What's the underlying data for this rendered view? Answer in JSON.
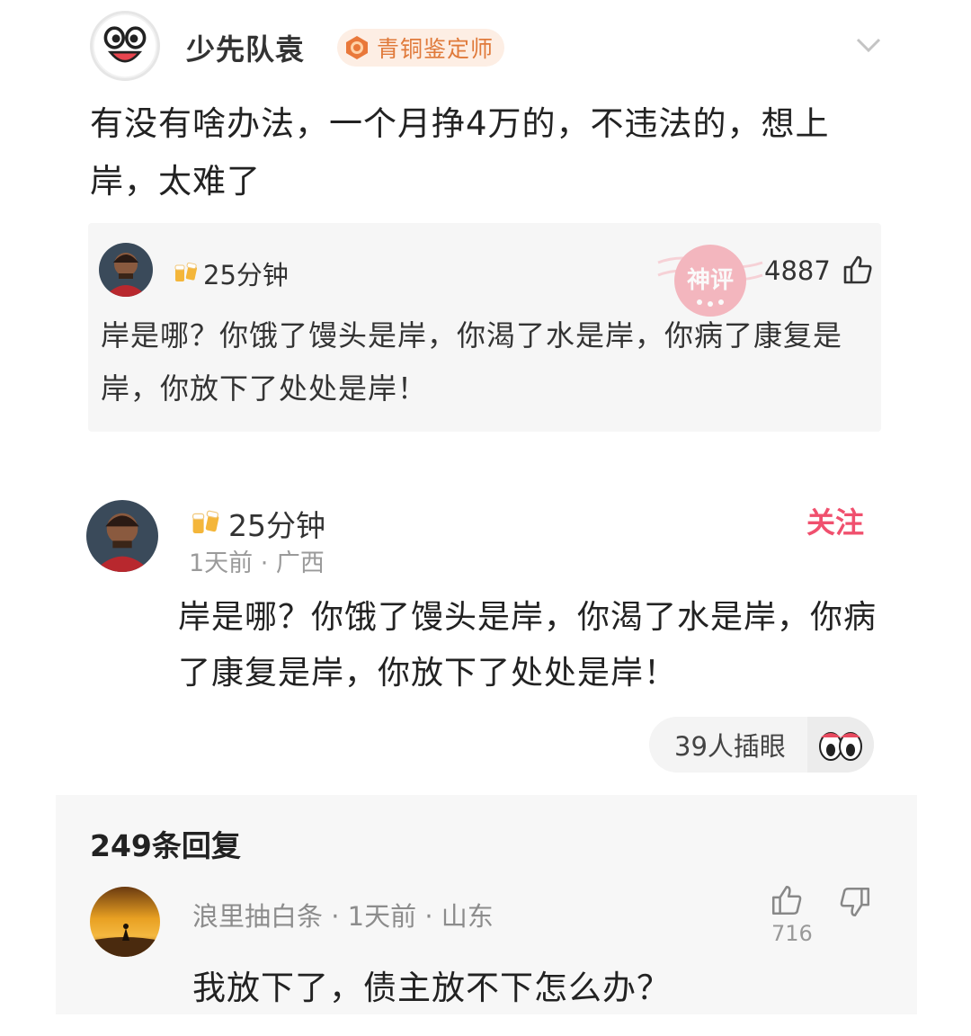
{
  "post": {
    "username": "少先队袁",
    "badge": {
      "label": "青铜鉴定师",
      "icon": "bronze-medal-icon"
    },
    "text": "有没有啥办法，一个月挣4万的，不违法的，想上岸，太难了"
  },
  "quoted_comment": {
    "name": "25分钟",
    "likes": "4887",
    "stamp_text": "神评",
    "text": "岸是哪？你饿了馒头是岸，你渴了水是岸，你病了康复是岸，你放下了处处是岸！"
  },
  "comment": {
    "name": "25分钟",
    "meta": "1天前 · 广西",
    "follow_label": "关注",
    "text": "岸是哪？你饿了馒头是岸，你渴了水是岸，你病了康复是岸，你放下了处处是岸！",
    "peek_label": "39人插眼"
  },
  "replies": {
    "count_label": "249条回复",
    "items": [
      {
        "meta": "浪里抽白条 · 1天前 · 山东",
        "likes": "716",
        "text": "我放下了，债主放不下怎么办？"
      }
    ]
  },
  "colors": {
    "accent_pink": "#f0506e",
    "badge_orange": "#e07a3b",
    "card_bg": "#f6f6f6"
  }
}
